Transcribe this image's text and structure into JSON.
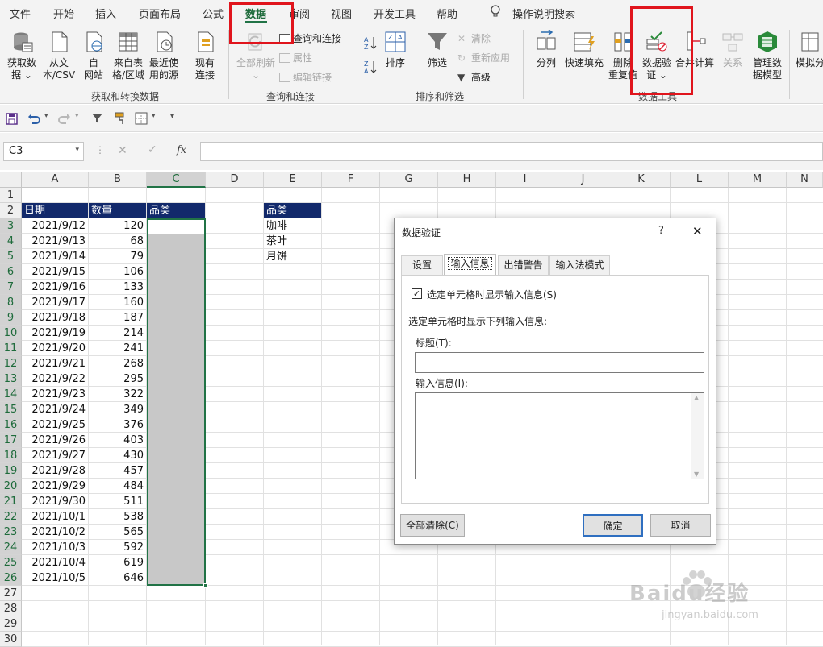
{
  "menu": {
    "tabs": [
      "文件",
      "开始",
      "插入",
      "页面布局",
      "公式",
      "数据",
      "审阅",
      "视图",
      "开发工具",
      "帮助"
    ],
    "active_tab": "数据",
    "tell_me": "操作说明搜索"
  },
  "ribbon": {
    "get_transform": {
      "label": "获取和转换数据",
      "get_data": [
        "获取数",
        "据 ⌄"
      ],
      "from_text": [
        "从文",
        "本/CSV"
      ],
      "from_web": [
        "自",
        "网站"
      ],
      "from_table": [
        "来自表",
        "格/区域"
      ],
      "recent_sources": [
        "最近使",
        "用的源"
      ],
      "existing_conn": [
        "现有",
        "连接"
      ]
    },
    "queries": {
      "label": "查询和连接",
      "refresh_all": [
        "全部刷新",
        "⌄"
      ],
      "queries_conn": "查询和连接",
      "properties": "属性",
      "edit_links": "编辑链接"
    },
    "sort_filter": {
      "label": "排序和筛选",
      "sort": "排序",
      "filter": "筛选",
      "clear": "清除",
      "reapply": "重新应用",
      "advanced": "高级"
    },
    "data_tools": {
      "label": "数据工具",
      "text_to_col": "分列",
      "flash_fill": "快速填充",
      "remove_dup": [
        "删除",
        "重复值"
      ],
      "validation": [
        "数据验",
        "证 ⌄"
      ],
      "consolidate": "合并计算",
      "relations": "关系",
      "data_model": [
        "管理数",
        "据模型"
      ]
    },
    "forecast": {
      "what_if": [
        "模拟分",
        ""
      ]
    }
  },
  "formula_bar": {
    "name_box": "C3",
    "fx": "fx",
    "formula": ""
  },
  "sheet": {
    "columns": [
      "A",
      "B",
      "C",
      "D",
      "E",
      "F",
      "G",
      "H",
      "I",
      "J",
      "K",
      "L",
      "M",
      "N"
    ],
    "rows": [
      "1",
      "2",
      "3",
      "4",
      "5",
      "6",
      "7",
      "8",
      "9",
      "10",
      "11",
      "12",
      "13",
      "14",
      "15",
      "16",
      "17",
      "18",
      "19",
      "20",
      "21",
      "22",
      "23",
      "24",
      "25",
      "26",
      "27",
      "28",
      "29",
      "30"
    ],
    "headers": {
      "date": "日期",
      "qty": "数量",
      "category": "品类"
    },
    "records": [
      [
        "2021/9/12",
        "120"
      ],
      [
        "2021/9/13",
        "68"
      ],
      [
        "2021/9/14",
        "79"
      ],
      [
        "2021/9/15",
        "106"
      ],
      [
        "2021/9/16",
        "133"
      ],
      [
        "2021/9/17",
        "160"
      ],
      [
        "2021/9/18",
        "187"
      ],
      [
        "2021/9/19",
        "214"
      ],
      [
        "2021/9/20",
        "241"
      ],
      [
        "2021/9/21",
        "268"
      ],
      [
        "2021/9/22",
        "295"
      ],
      [
        "2021/9/23",
        "322"
      ],
      [
        "2021/9/24",
        "349"
      ],
      [
        "2021/9/25",
        "376"
      ],
      [
        "2021/9/26",
        "403"
      ],
      [
        "2021/9/27",
        "430"
      ],
      [
        "2021/9/28",
        "457"
      ],
      [
        "2021/9/29",
        "484"
      ],
      [
        "2021/9/30",
        "511"
      ],
      [
        "2021/10/1",
        "538"
      ],
      [
        "2021/10/2",
        "565"
      ],
      [
        "2021/10/3",
        "592"
      ],
      [
        "2021/10/4",
        "619"
      ],
      [
        "2021/10/5",
        "646"
      ]
    ],
    "category_list": {
      "header": "品类",
      "items": [
        "咖啡",
        "茶叶",
        "月饼"
      ]
    }
  },
  "dialog": {
    "title": "数据验证",
    "help": "?",
    "close": "✕",
    "tabs": [
      "设置",
      "输入信息",
      "出错警告",
      "输入法模式"
    ],
    "active_tab": "输入信息",
    "show_checkbox": "选定单元格时显示输入信息(S)",
    "show_checked": true,
    "section": "选定单元格时显示下列输入信息:",
    "title_label": "标题(T):",
    "title_value": "",
    "message_label": "输入信息(I):",
    "message_value": "",
    "clear_all": "全部清除(C)",
    "ok": "确定",
    "cancel": "取消"
  },
  "watermark": {
    "brand": "Baidu经验",
    "url": "jingyan.baidu.com"
  },
  "colors": {
    "accent": "#217346",
    "header_fill": "#12296b",
    "highlight": "#e0141c",
    "selection": "#c6c6c6"
  }
}
